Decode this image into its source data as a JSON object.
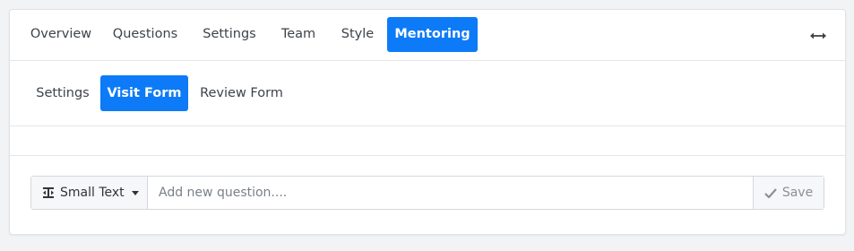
{
  "top_tabs": [
    {
      "label": "Overview",
      "active": false
    },
    {
      "label": "Questions",
      "active": false
    },
    {
      "label": "Settings",
      "active": false
    },
    {
      "label": "Team",
      "active": false
    },
    {
      "label": "Style",
      "active": false
    },
    {
      "label": "Mentoring",
      "active": true
    }
  ],
  "sub_tabs": [
    {
      "label": "Settings",
      "active": false
    },
    {
      "label": "Visit Form",
      "active": true
    },
    {
      "label": "Review Form",
      "active": false
    }
  ],
  "question_editor": {
    "type_label": "Small Text",
    "type_icon": "text-field-icon",
    "input_value": "",
    "input_placeholder": "Add new question....",
    "save_label": "Save",
    "save_icon": "check-icon"
  },
  "header_actions": {
    "expand_icon": "horizontal-arrows-icon"
  },
  "colors": {
    "accent": "#0d7bf7",
    "background": "#f2f3f5",
    "card": "#ffffff"
  }
}
